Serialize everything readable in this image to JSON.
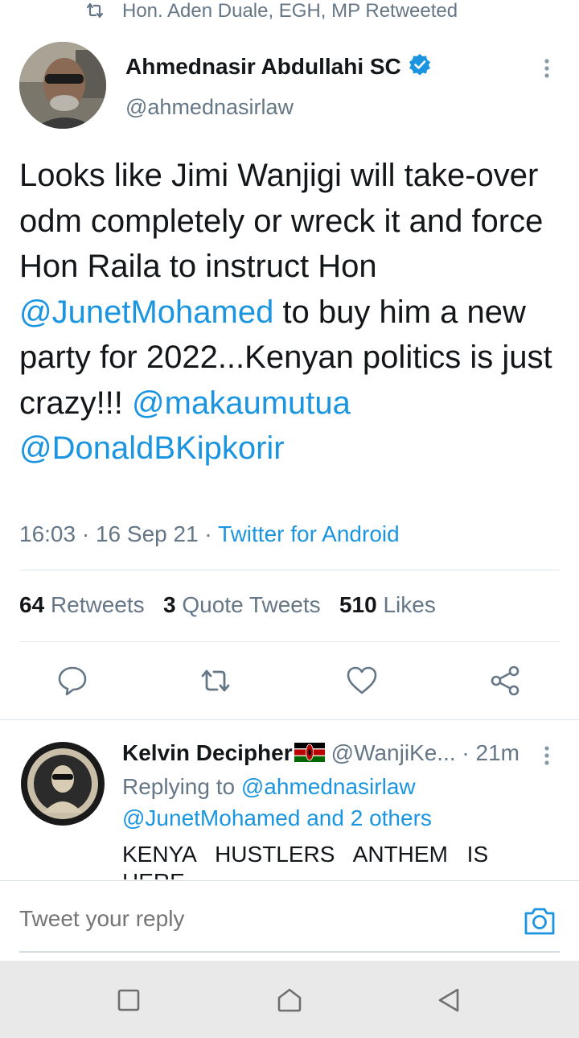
{
  "retweet_bar": {
    "text": "Hon. Aden Duale, EGH, MP Retweeted"
  },
  "author": {
    "name": "Ahmednasir Abdullahi SC",
    "handle": "@ahmednasirlaw"
  },
  "tweet": {
    "segments": [
      {
        "text": "Looks like Jimi Wanjigi will take-over odm completely or wreck it and force Hon Raila to instruct Hon ",
        "type": "text"
      },
      {
        "text": "@JunetMohamed",
        "type": "mention"
      },
      {
        "text": " to buy him a new party for 2022...Kenyan politics is just crazy!!! ",
        "type": "text"
      },
      {
        "text": "@makaumutua",
        "type": "mention"
      },
      {
        "text": " ",
        "type": "text"
      },
      {
        "text": "@DonaldBKipkorir",
        "type": "mention"
      }
    ],
    "time": "16:03",
    "date": "16 Sep 21",
    "sep": "·",
    "source": "Twitter for Android"
  },
  "stats": {
    "retweets_count": "64",
    "retweets_label": "Retweets",
    "quotes_count": "3",
    "quotes_label": "Quote Tweets",
    "likes_count": "510",
    "likes_label": "Likes"
  },
  "actions": [
    "reply-icon",
    "retweet-icon",
    "like-icon",
    "share-icon"
  ],
  "reply": {
    "name": "Kelvin Decipher",
    "handle": "@WanjiKe...",
    "sep": "·",
    "time": "21m",
    "replying_prefix": "Replying to",
    "replying_handle": "@ahmednasirlaw",
    "replying_line2_handle": "@JunetMohamed",
    "replying_line2_rest": "and 2 others",
    "text": "KENYA HUSTLERS ANTHEM IS HERE"
  },
  "compose": {
    "placeholder": "Tweet your reply"
  },
  "colors": {
    "link": "#1b95e0",
    "secondary_text": "#657786",
    "primary_text": "#14171a",
    "divider": "#e1e8ed",
    "nav_bar": "#e9e9e9"
  },
  "nav": [
    "recents-icon",
    "home-icon",
    "back-icon"
  ]
}
